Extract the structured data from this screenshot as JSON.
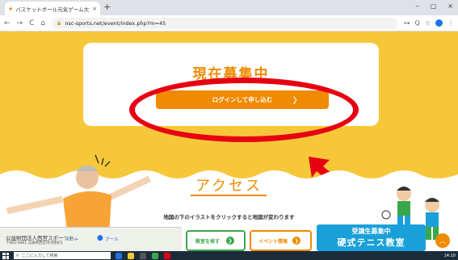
{
  "browser": {
    "tab_title": "バスケットボール元気ゲーム大会 | イベ",
    "tab_close": "×",
    "new_tab": "+",
    "url": "nsc-sports.net/event/index.php?m=45",
    "win_min": "–",
    "win_max": "▢",
    "win_close": "×",
    "nav_back": "←",
    "nav_forward": "→",
    "nav_reload": "C",
    "nav_home": "⌂",
    "lock": "🔒",
    "ext_key": "⊶",
    "ext_zoom": "Q",
    "ext_star": "☆",
    "ext_menu": "⋮"
  },
  "card": {
    "heading": "現在募集中",
    "login_button": "ログインして申し込む",
    "login_chevron": "〉"
  },
  "access": {
    "title": "アクセス",
    "note": "地図の下のイラストをクリックすると地図が変わります"
  },
  "bottom": {
    "org_name": "公益財団法人西宮スポーツセ...",
    "org_addr": "〒662-0861 兵庫県西宮市河原町1",
    "place_pool": "プール",
    "place_route": "ルート",
    "class_button": "教室を探す",
    "event_button": "イベント情報",
    "circle_arrow": "❯",
    "banner_top": "受講生募集中",
    "banner_main": "硬式テニス教室",
    "scroll_top": "︿"
  },
  "taskbar": {
    "search_placeholder": "ここに入力して検索",
    "clock": "14:10"
  },
  "colors": {
    "background": "#f7c73a",
    "accent": "#f08a00",
    "annotation_red": "#e60012",
    "green": "#3aa84a",
    "banner": "#1aa0d8"
  }
}
